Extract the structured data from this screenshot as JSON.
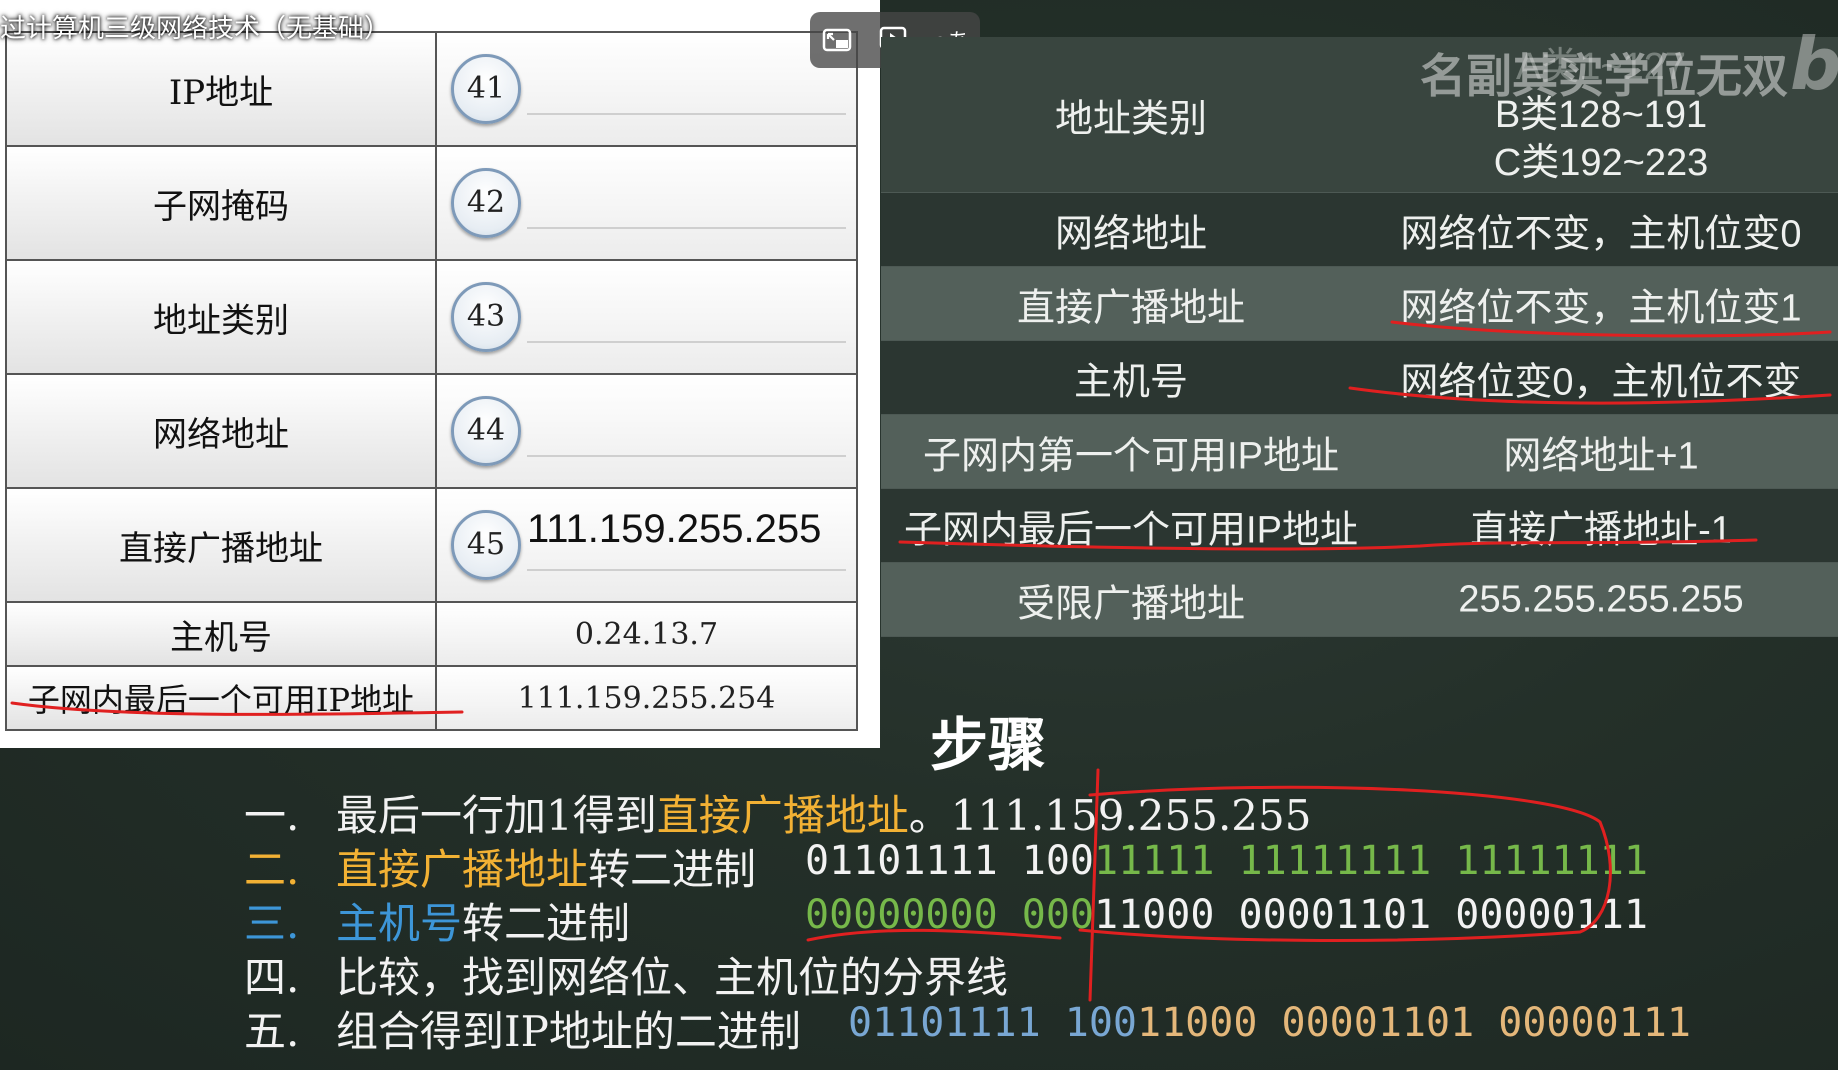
{
  "video": {
    "title": "过计算机三级网络技术（无基础）"
  },
  "left_table": {
    "rows": [
      {
        "label": "IP地址",
        "num": "41",
        "answer": ""
      },
      {
        "label": "子网掩码",
        "num": "42",
        "answer": ""
      },
      {
        "label": "地址类别",
        "num": "43",
        "answer": ""
      },
      {
        "label": "网络地址",
        "num": "44",
        "answer": ""
      },
      {
        "label": "直接广播地址",
        "num": "45",
        "answer": "111.159.255.255"
      }
    ],
    "host": {
      "label": "主机号",
      "value": "0.24.13.7"
    },
    "last": {
      "label": "子网内最后一个可用IP地址",
      "value": "111.159.255.254"
    }
  },
  "player": {
    "icons": [
      "pip-icon",
      "playback-icon",
      "translate-icon"
    ],
    "translate_label": "aあ"
  },
  "watermark": {
    "text": "名副其实学位无双",
    "logo": "b"
  },
  "right_table": {
    "rows": [
      {
        "label": "地址类别",
        "value_lines": [
          "A类1~127",
          "B类128~191",
          "C类192~223"
        ]
      },
      {
        "label": "网络地址",
        "value": "网络位不变，主机位变0"
      },
      {
        "label": "直接广播地址",
        "value": "网络位不变，主机位变1"
      },
      {
        "label": "主机号",
        "value": "网络位变0，主机位不变"
      },
      {
        "label": "子网内第一个可用IP地址",
        "value": "网络地址+1"
      },
      {
        "label": "子网内最后一个可用IP地址",
        "value": "直接广播地址-1"
      },
      {
        "label": "受限广播地址",
        "value": "255.255.255.255"
      }
    ]
  },
  "steps": {
    "title": "步骤",
    "s1": {
      "num": "一.",
      "text1": "最后一行加1得到",
      "hl": "直接广播地址",
      "text2": "。111.159.255.255"
    },
    "s2": {
      "num": "二.",
      "hl": "直接广播地址",
      "text": "转二进制",
      "b1": "01101111",
      "b2a": "100",
      "b2b": "11111",
      "b3": "11111111",
      "b4": "11111111"
    },
    "s3": {
      "num": "三.",
      "hl": "主机号",
      "text": "转二进制",
      "b1": "00000000",
      "b2a": "000",
      "b2b": "11000",
      "b3": "00001101",
      "b4": "00000111"
    },
    "s4": {
      "num": "四.",
      "text": "比较，找到网络位、主机位的分界线"
    },
    "s5": {
      "num": "五.",
      "text": "组合得到IP地址的二进制",
      "b1": "01101111",
      "b2a": "100",
      "b2b": "11000",
      "b3": "00001101",
      "b4": "00000111"
    }
  },
  "colors": {
    "orange": "#f2b134",
    "blue": "#3d96d8",
    "green": "#76b84a",
    "annotation_red": "#e02020"
  }
}
